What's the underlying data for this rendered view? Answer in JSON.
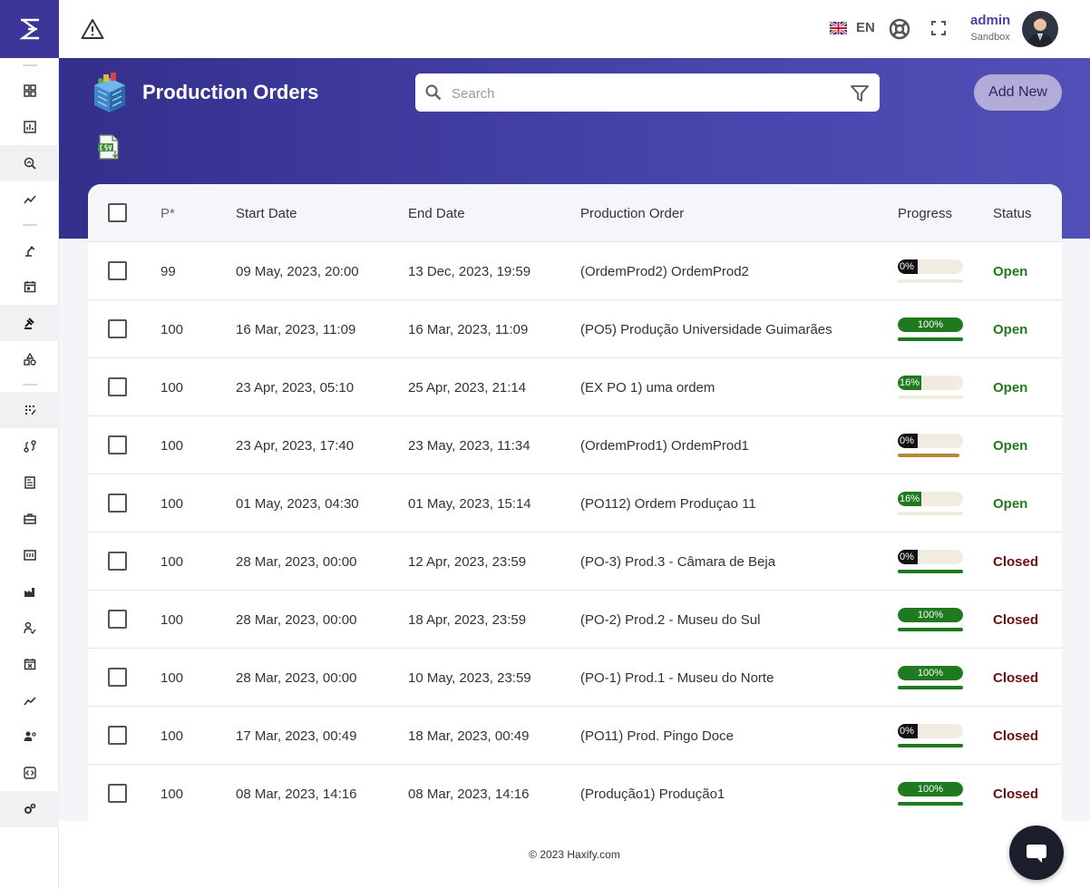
{
  "topbar": {
    "language_code": "EN",
    "user_name": "admin",
    "user_environment": "Sandbox"
  },
  "page": {
    "title": "Production Orders",
    "search_placeholder": "Search",
    "add_label": "Add New"
  },
  "table": {
    "headers": {
      "priority": "P*",
      "start_date": "Start Date",
      "end_date": "End Date",
      "order": "Production Order",
      "progress": "Progress",
      "status": "Status"
    },
    "rows": [
      {
        "priority": "99",
        "start": "09 May, 2023, 20:00",
        "end": "13 Dec, 2023, 19:59",
        "order": "(OrdemProd2) OrdemProd2",
        "progress": 0,
        "progress_label": "0%",
        "status": "Open"
      },
      {
        "priority": "100",
        "start": "16 Mar, 2023, 11:09",
        "end": "16 Mar, 2023, 11:09",
        "order": "(PO5) Produção Universidade Guimarães",
        "progress": 100,
        "progress_label": "100%",
        "status": "Open"
      },
      {
        "priority": "100",
        "start": "23 Apr, 2023, 05:10",
        "end": "25 Apr, 2023, 21:14",
        "order": "(EX PO 1) uma ordem",
        "progress": 16,
        "progress_label": "16%",
        "status": "Open"
      },
      {
        "priority": "100",
        "start": "23 Apr, 2023, 17:40",
        "end": "23 May, 2023, 11:34",
        "order": "(OrdemProd1) OrdemProd1",
        "progress": 0,
        "progress_label": "0%",
        "status": "Open"
      },
      {
        "priority": "100",
        "start": "01 May, 2023, 04:30",
        "end": "01 May, 2023, 15:14",
        "order": "(PO112) Ordem Produçao 11",
        "progress": 16,
        "progress_label": "16%",
        "status": "Open"
      },
      {
        "priority": "100",
        "start": "28 Mar, 2023, 00:00",
        "end": "12 Apr, 2023, 23:59",
        "order": "(PO-3) Prod.3 - Câmara de Beja",
        "progress": 0,
        "progress_label": "0%",
        "status": "Closed"
      },
      {
        "priority": "100",
        "start": "28 Mar, 2023, 00:00",
        "end": "18 Apr, 2023, 23:59",
        "order": "(PO-2) Prod.2 - Museu do Sul",
        "progress": 100,
        "progress_label": "100%",
        "status": "Closed"
      },
      {
        "priority": "100",
        "start": "28 Mar, 2023, 00:00",
        "end": "10 May, 2023, 23:59",
        "order": "(PO-1) Prod.1 - Museu do Norte",
        "progress": 100,
        "progress_label": "100%",
        "status": "Closed"
      },
      {
        "priority": "100",
        "start": "17 Mar, 2023, 00:49",
        "end": "18 Mar, 2023, 00:49",
        "order": "(PO11) Prod. Pingo Doce",
        "progress": 0,
        "progress_label": "0%",
        "status": "Closed"
      },
      {
        "priority": "100",
        "start": "08 Mar, 2023, 14:16",
        "end": "08 Mar, 2023, 14:16",
        "order": "(Produção1) Produção1",
        "progress": 100,
        "progress_label": "100%",
        "status": "Closed"
      }
    ]
  },
  "footer": {
    "copyright": "© 2023 Haxify.com"
  },
  "colors": {
    "brand": "#3b3598",
    "progress_green": "#1f7a1f",
    "progress_empty": "#f1ece2",
    "underline_warning": "#b8873a",
    "status_open": "#207a20",
    "status_closed": "#6a1010"
  },
  "icons": {
    "sidebar": [
      "dashboard-icon",
      "report-icon",
      "analysis-icon",
      "trend-icon",
      "robot-arm-icon",
      "calendar-icon",
      "gavel-icon",
      "shapes-icon",
      "grid-icon",
      "route-icon",
      "document-icon",
      "toolbox-icon",
      "ticket-icon",
      "factory-icon",
      "hand-check-icon",
      "calendar-x-icon",
      "line-chart-icon",
      "users-settings-icon",
      "code-icon",
      "gears-icon"
    ]
  }
}
